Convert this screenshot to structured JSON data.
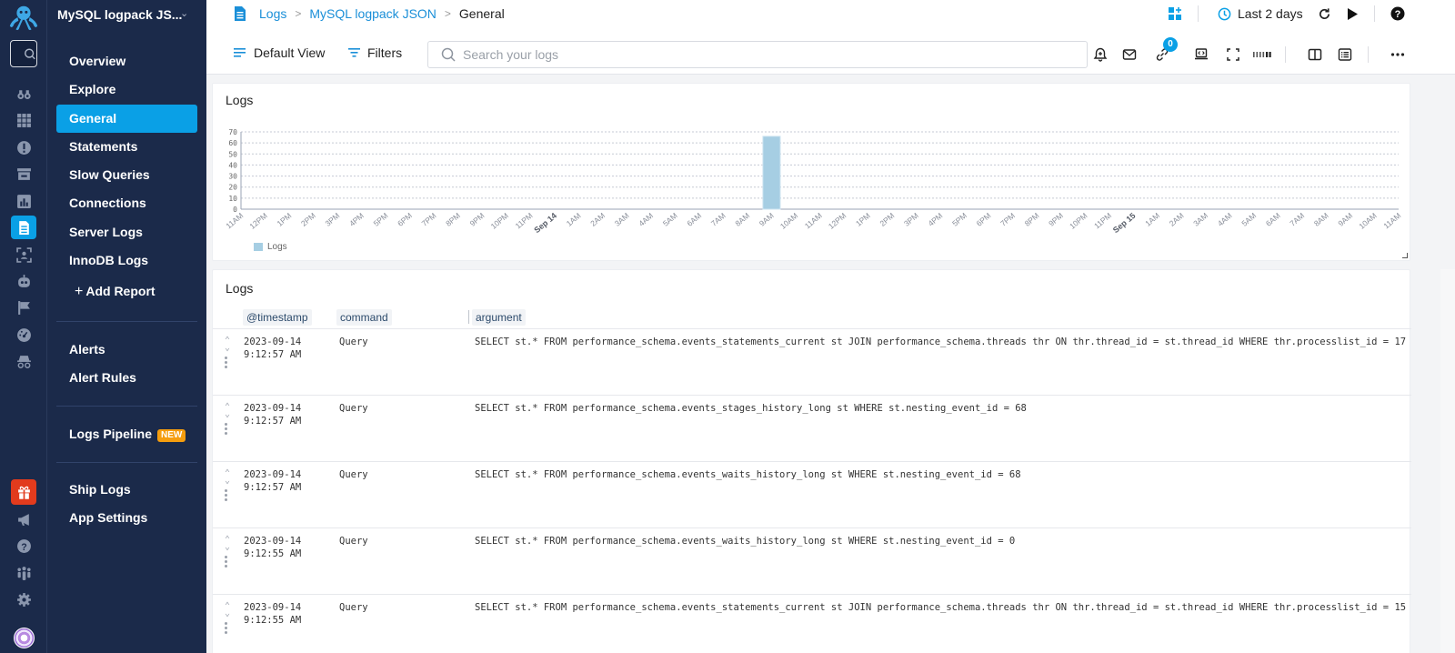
{
  "rail": {
    "icons": [
      "octopus-logo",
      "search-icon",
      "binoculars-icon",
      "grid-icon",
      "alert-circle-icon",
      "archive-icon",
      "bar-chart-icon",
      "document-icon",
      "user-scan-icon",
      "robot-icon",
      "flag-icon",
      "gauge-icon",
      "spy-icon",
      "gift-icon",
      "megaphone-icon",
      "help-icon",
      "team-icon",
      "gear-icon",
      "avatar"
    ]
  },
  "nav": {
    "app_title": "MySQL logpack JS...",
    "items": [
      {
        "label": "Overview"
      },
      {
        "label": "Explore"
      },
      {
        "label": "General",
        "active": true
      },
      {
        "label": "Statements"
      },
      {
        "label": "Slow Queries"
      },
      {
        "label": "Connections"
      },
      {
        "label": "Server Logs"
      },
      {
        "label": "InnoDB Logs"
      }
    ],
    "add_report": "Add Report",
    "alerts": "Alerts",
    "alert_rules": "Alert Rules",
    "logs_pipeline": "Logs Pipeline",
    "new_badge": "NEW",
    "ship_logs": "Ship Logs",
    "app_settings": "App Settings"
  },
  "header": {
    "breadcrumb": [
      "Logs",
      "MySQL logpack JSON",
      "General"
    ],
    "time_range": "Last 2 days",
    "default_view": "Default View",
    "filters": "Filters",
    "search_placeholder": "Search your logs",
    "search_value": "",
    "linked_count": "0"
  },
  "chart_panel": {
    "title": "Logs",
    "legend": "Logs"
  },
  "chart_data": {
    "type": "bar",
    "title": "Logs",
    "xlabel": "",
    "ylabel": "",
    "ylim": [
      0,
      70
    ],
    "yticks": [
      0,
      10,
      20,
      30,
      40,
      50,
      60,
      70
    ],
    "grid": true,
    "legend_position": "bottom-left",
    "categories": [
      "11AM",
      "12PM",
      "1PM",
      "2PM",
      "3PM",
      "4PM",
      "5PM",
      "6PM",
      "7PM",
      "8PM",
      "9PM",
      "10PM",
      "11PM",
      "Sep 14",
      "1AM",
      "2AM",
      "3AM",
      "4AM",
      "5AM",
      "6AM",
      "7AM",
      "8AM",
      "9AM",
      "10AM",
      "11AM",
      "12PM",
      "1PM",
      "2PM",
      "3PM",
      "4PM",
      "5PM",
      "6PM",
      "7PM",
      "8PM",
      "9PM",
      "10PM",
      "11PM",
      "Sep 15",
      "1AM",
      "2AM",
      "3AM",
      "4AM",
      "5AM",
      "6AM",
      "7AM",
      "8AM",
      "9AM",
      "10AM",
      "11AM"
    ],
    "bold_categories": [
      "Sep 14",
      "Sep 15"
    ],
    "series": [
      {
        "name": "Logs",
        "color": "#a6cee3",
        "values": [
          0,
          0,
          0,
          0,
          0,
          0,
          0,
          0,
          0,
          0,
          0,
          0,
          0,
          0,
          0,
          0,
          0,
          0,
          0,
          0,
          0,
          0,
          66,
          0,
          0,
          0,
          0,
          0,
          0,
          0,
          0,
          0,
          0,
          0,
          0,
          0,
          0,
          0,
          0,
          0,
          0,
          0,
          0,
          0,
          0,
          0,
          0,
          0,
          0
        ]
      }
    ]
  },
  "logs_panel": {
    "title": "Logs",
    "columns": [
      "@timestamp",
      "command",
      "argument"
    ],
    "rows": [
      {
        "date": "2023-09-14",
        "time": "9:12:57 AM",
        "command": "Query",
        "argument": "SELECT st.* FROM performance_schema.events_statements_current st JOIN performance_schema.threads thr ON thr.thread_id = st.thread_id WHERE thr.processlist_id = 17"
      },
      {
        "date": "2023-09-14",
        "time": "9:12:57 AM",
        "command": "Query",
        "argument": "SELECT st.* FROM performance_schema.events_stages_history_long st WHERE st.nesting_event_id = 68"
      },
      {
        "date": "2023-09-14",
        "time": "9:12:57 AM",
        "command": "Query",
        "argument": "SELECT st.* FROM performance_schema.events_waits_history_long st WHERE st.nesting_event_id = 68"
      },
      {
        "date": "2023-09-14",
        "time": "9:12:55 AM",
        "command": "Query",
        "argument": "SELECT st.* FROM performance_schema.events_waits_history_long st WHERE st.nesting_event_id = 0"
      },
      {
        "date": "2023-09-14",
        "time": "9:12:55 AM",
        "command": "Query",
        "argument": "SELECT st.* FROM performance_schema.events_statements_current st JOIN performance_schema.threads thr ON thr.thread_id = st.thread_id WHERE thr.processlist_id = 15"
      }
    ]
  },
  "colors": {
    "sidebar_bg": "#1b2a4a",
    "accent": "#0aa0e6",
    "new_badge": "#f59d0e",
    "gift": "#e23b1d",
    "bar": "#a6cee3",
    "link": "#1a8fd8"
  }
}
